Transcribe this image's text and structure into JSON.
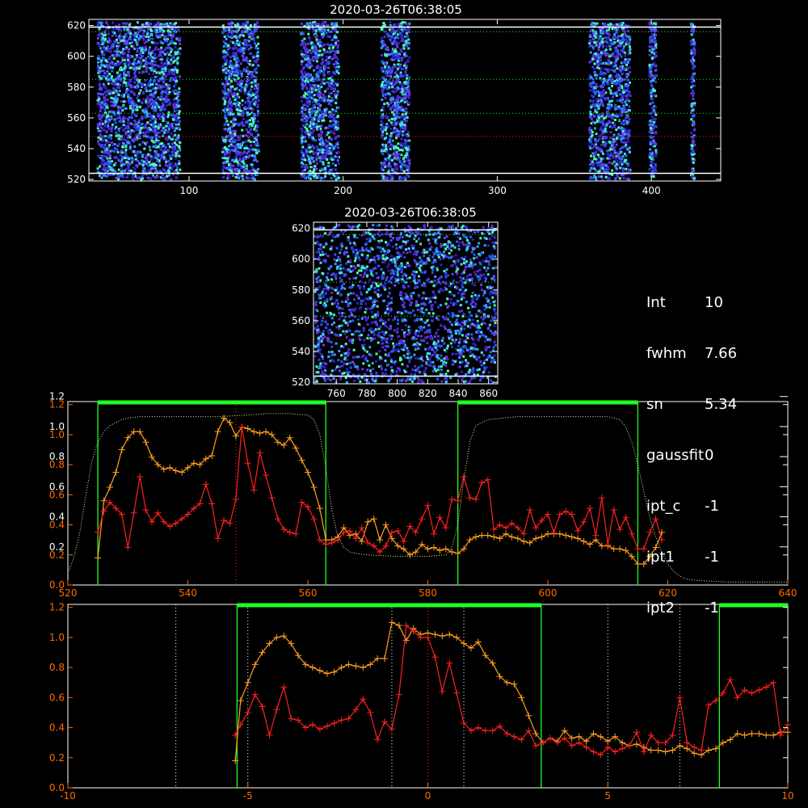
{
  "info": {
    "rows": [
      {
        "key": "Int",
        "value": "10"
      },
      {
        "key": "fwhm",
        "value": "7.66"
      },
      {
        "key": "sn",
        "value": "5.34"
      },
      {
        "key": "gaussfit",
        "value": "0"
      },
      {
        "key": "ipt_c",
        "value": "-1"
      },
      {
        "key": "ipt1",
        "value": "-1"
      },
      {
        "key": "ipt2",
        "value": "-1"
      }
    ]
  },
  "colors": {
    "red": "#ff2020",
    "orange": "#ffa020",
    "green": "#20ff20",
    "dotted": "#c8ffa0",
    "axis": "#ff6a00"
  },
  "chart_data": [
    {
      "type": "heatmap",
      "title": "2020-03-26T06:38:05",
      "xlim": [
        35,
        445
      ],
      "ylim": [
        519,
        624
      ],
      "xticks": [
        100,
        200,
        300,
        400
      ],
      "yticks": [
        520,
        540,
        560,
        580,
        600,
        620
      ],
      "hlines_white": [
        524,
        619
      ],
      "hlines_green_dotted": [
        563,
        585,
        616
      ],
      "hlines_red_dotted": [
        548
      ],
      "bands": [
        [
          40,
          95
        ],
        [
          121,
          146
        ],
        [
          172,
          198
        ],
        [
          224,
          244
        ],
        [
          359,
          387
        ],
        [
          398,
          404
        ],
        [
          425,
          429
        ]
      ]
    },
    {
      "type": "heatmap",
      "title": "2020-03-26T06:38:05",
      "xlim": [
        745,
        866
      ],
      "ylim": [
        519,
        624
      ],
      "xticks": [
        760,
        780,
        800,
        820,
        840,
        860
      ],
      "yticks": [
        520,
        540,
        560,
        580,
        600,
        620
      ],
      "hlines_white": [
        524,
        619
      ],
      "hlines_green_dotted": [
        563,
        585,
        616
      ],
      "hlines_red_dotted": [
        548
      ]
    },
    {
      "type": "line",
      "xlim": [
        520,
        640
      ],
      "ylim": [
        0,
        1.22
      ],
      "xticks": [
        520,
        540,
        560,
        580,
        600,
        620,
        640
      ],
      "yticks_orange": [
        0.0,
        0.2,
        0.4,
        0.6,
        0.8,
        1.0,
        1.2
      ],
      "yticks_white": [
        0.2,
        0.4,
        0.6,
        0.8,
        1.0,
        1.2
      ],
      "green_vlines": [
        525,
        563,
        585,
        615
      ],
      "green_bars": [
        [
          525,
          563
        ],
        [
          585,
          615
        ]
      ],
      "red_vline": 548,
      "series": [
        {
          "color": "orange",
          "x": [
            525,
            526,
            527,
            528,
            529,
            530,
            531,
            532,
            533,
            534,
            535,
            536,
            537,
            538,
            539,
            540,
            541,
            542,
            543,
            544,
            545,
            546,
            547,
            548,
            549,
            550,
            551,
            552,
            553,
            554,
            555,
            556,
            557,
            558,
            559,
            560,
            561,
            562,
            563,
            564,
            565,
            566,
            567,
            568,
            569,
            570,
            571,
            572,
            573,
            574,
            575,
            576,
            577,
            578,
            579,
            580,
            581,
            582,
            583,
            584,
            585,
            586,
            587,
            588,
            589,
            590,
            591,
            592,
            593,
            594,
            595,
            596,
            597,
            598,
            599,
            600,
            601,
            602,
            603,
            604,
            605,
            606,
            607,
            608,
            609,
            610,
            611,
            612,
            613,
            614,
            615,
            616,
            617,
            618,
            619
          ],
          "y": [
            0.18,
            0.56,
            0.65,
            0.75,
            0.9,
            0.98,
            1.02,
            1.02,
            0.95,
            0.85,
            0.8,
            0.77,
            0.78,
            0.76,
            0.75,
            0.78,
            0.81,
            0.8,
            0.84,
            0.86,
            1.02,
            1.11,
            1.08,
            0.99,
            1.05,
            1.04,
            1.02,
            1.01,
            1.02,
            1.0,
            0.95,
            0.93,
            0.98,
            0.91,
            0.83,
            0.75,
            0.65,
            0.51,
            0.3,
            0.3,
            0.32,
            0.38,
            0.33,
            0.34,
            0.29,
            0.42,
            0.44,
            0.3,
            0.4,
            0.31,
            0.26,
            0.24,
            0.2,
            0.22,
            0.27,
            0.24,
            0.25,
            0.23,
            0.24,
            0.22,
            0.21,
            0.24,
            0.3,
            0.32,
            0.33,
            0.33,
            0.32,
            0.31,
            0.34,
            0.32,
            0.31,
            0.29,
            0.28,
            0.31,
            0.32,
            0.34,
            0.34,
            0.34,
            0.33,
            0.32,
            0.31,
            0.29,
            0.27,
            0.3,
            0.26,
            0.26,
            0.24,
            0.24,
            0.23,
            0.19,
            0.14,
            0.14,
            0.19,
            0.25,
            0.35
          ]
        },
        {
          "color": "red",
          "x": [
            525,
            526,
            527,
            528,
            529,
            530,
            531,
            532,
            533,
            534,
            535,
            536,
            537,
            538,
            539,
            540,
            541,
            542,
            543,
            544,
            545,
            546,
            547,
            548,
            549,
            550,
            551,
            552,
            553,
            554,
            555,
            556,
            557,
            558,
            559,
            560,
            561,
            562,
            563,
            564,
            565,
            566,
            567,
            568,
            569,
            570,
            571,
            572,
            573,
            574,
            575,
            576,
            577,
            578,
            579,
            580,
            581,
            582,
            583,
            584,
            585,
            586,
            587,
            588,
            589,
            590,
            591,
            592,
            593,
            594,
            595,
            596,
            597,
            598,
            599,
            600,
            601,
            602,
            603,
            604,
            605,
            606,
            607,
            608,
            609,
            610,
            611,
            612,
            613,
            614,
            615,
            616,
            617,
            618,
            619
          ],
          "y": [
            0.35,
            0.49,
            0.55,
            0.51,
            0.47,
            0.25,
            0.48,
            0.72,
            0.5,
            0.42,
            0.48,
            0.42,
            0.39,
            0.41,
            0.44,
            0.47,
            0.51,
            0.54,
            0.67,
            0.54,
            0.31,
            0.43,
            0.41,
            0.57,
            1.05,
            0.81,
            0.63,
            0.88,
            0.73,
            0.58,
            0.44,
            0.37,
            0.35,
            0.34,
            0.55,
            0.52,
            0.44,
            0.3,
            0.27,
            0.28,
            0.3,
            0.35,
            0.36,
            0.31,
            0.38,
            0.28,
            0.26,
            0.22,
            0.26,
            0.35,
            0.36,
            0.29,
            0.39,
            0.35,
            0.44,
            0.53,
            0.34,
            0.45,
            0.38,
            0.57,
            0.56,
            0.72,
            0.58,
            0.57,
            0.68,
            0.7,
            0.37,
            0.4,
            0.38,
            0.41,
            0.38,
            0.34,
            0.5,
            0.38,
            0.43,
            0.47,
            0.35,
            0.47,
            0.49,
            0.47,
            0.36,
            0.42,
            0.51,
            0.33,
            0.58,
            0.27,
            0.5,
            0.37,
            0.45,
            0.34,
            0.24,
            0.24,
            0.35,
            0.44,
            0.3
          ]
        },
        {
          "color": "dotted",
          "x": [
            520,
            521,
            522,
            523,
            524,
            525,
            526,
            527,
            528,
            529,
            530,
            532,
            535,
            540,
            545,
            550,
            553,
            555,
            557,
            560,
            561,
            562,
            563,
            564,
            565,
            566,
            567,
            568,
            570,
            575,
            580,
            583,
            584,
            585,
            586,
            587,
            588,
            590,
            595,
            600,
            605,
            610,
            612,
            613,
            614,
            615,
            616,
            617,
            618,
            619,
            620,
            621,
            622,
            623,
            625,
            630,
            635,
            640
          ],
          "y": [
            0.08,
            0.18,
            0.35,
            0.6,
            0.82,
            0.95,
            1.02,
            1.06,
            1.08,
            1.1,
            1.11,
            1.12,
            1.12,
            1.12,
            1.12,
            1.13,
            1.14,
            1.14,
            1.14,
            1.13,
            1.1,
            1.0,
            0.78,
            0.5,
            0.32,
            0.25,
            0.22,
            0.21,
            0.2,
            0.19,
            0.19,
            0.2,
            0.25,
            0.4,
            0.7,
            0.95,
            1.06,
            1.1,
            1.12,
            1.12,
            1.12,
            1.12,
            1.1,
            1.05,
            0.95,
            0.8,
            0.62,
            0.45,
            0.32,
            0.22,
            0.14,
            0.09,
            0.06,
            0.04,
            0.03,
            0.02,
            0.02,
            0.02
          ]
        }
      ]
    },
    {
      "type": "line",
      "xlim": [
        -10,
        10
      ],
      "ylim": [
        0,
        1.22
      ],
      "xticks": [
        -10,
        -5,
        0,
        5,
        10
      ],
      "yticks": [
        0.0,
        0.2,
        0.4,
        0.6,
        0.8,
        1.0,
        1.2
      ],
      "green_vlines": [
        -5.3,
        3.15,
        8.1
      ],
      "green_bars": [
        [
          -5.3,
          3.15
        ],
        [
          8.1,
          10
        ]
      ],
      "white_dotted_vlines": [
        -7,
        -5,
        -1,
        1,
        5,
        7
      ],
      "red_vline": 0,
      "series": [
        {
          "color": "orange",
          "x": [
            -5.35,
            -5.2,
            -5.0,
            -4.8,
            -4.6,
            -4.4,
            -4.2,
            -4.0,
            -3.8,
            -3.6,
            -3.4,
            -3.2,
            -3.0,
            -2.8,
            -2.6,
            -2.4,
            -2.2,
            -2.0,
            -1.8,
            -1.6,
            -1.4,
            -1.2,
            -1.0,
            -0.8,
            -0.6,
            -0.4,
            -0.2,
            0.0,
            0.2,
            0.4,
            0.6,
            0.8,
            1.0,
            1.2,
            1.4,
            1.6,
            1.8,
            2.0,
            2.2,
            2.4,
            2.6,
            2.8,
            3.0,
            3.2,
            3.4,
            3.6,
            3.8,
            4.0,
            4.2,
            4.4,
            4.6,
            4.8,
            5.0,
            5.2,
            5.4,
            5.6,
            5.8,
            6.0,
            6.2,
            6.4,
            6.6,
            6.8,
            7.0,
            7.2,
            7.4,
            7.6,
            7.8,
            8.0,
            8.2,
            8.4,
            8.6,
            8.8,
            9.0,
            9.2,
            9.4,
            9.6,
            9.8,
            10.0
          ],
          "y": [
            0.18,
            0.58,
            0.7,
            0.82,
            0.9,
            0.96,
            1.0,
            1.01,
            0.96,
            0.88,
            0.82,
            0.8,
            0.78,
            0.76,
            0.77,
            0.8,
            0.82,
            0.81,
            0.8,
            0.82,
            0.86,
            0.86,
            1.1,
            1.08,
            0.98,
            1.06,
            1.02,
            1.03,
            1.02,
            1.01,
            1.02,
            1.0,
            0.96,
            0.93,
            0.97,
            0.88,
            0.83,
            0.74,
            0.7,
            0.69,
            0.6,
            0.48,
            0.36,
            0.3,
            0.33,
            0.31,
            0.38,
            0.33,
            0.34,
            0.31,
            0.36,
            0.34,
            0.31,
            0.34,
            0.3,
            0.28,
            0.29,
            0.27,
            0.25,
            0.25,
            0.24,
            0.25,
            0.28,
            0.26,
            0.23,
            0.22,
            0.25,
            0.26,
            0.3,
            0.32,
            0.36,
            0.35,
            0.36,
            0.36,
            0.35,
            0.35,
            0.37,
            0.37
          ]
        },
        {
          "color": "red",
          "x": [
            -5.35,
            -5.2,
            -5.0,
            -4.8,
            -4.6,
            -4.4,
            -4.2,
            -4.0,
            -3.8,
            -3.6,
            -3.4,
            -3.2,
            -3.0,
            -2.8,
            -2.6,
            -2.4,
            -2.2,
            -2.0,
            -1.8,
            -1.6,
            -1.4,
            -1.2,
            -1.0,
            -0.8,
            -0.6,
            -0.4,
            -0.2,
            0.0,
            0.2,
            0.4,
            0.6,
            0.8,
            1.0,
            1.2,
            1.4,
            1.6,
            1.8,
            2.0,
            2.2,
            2.4,
            2.6,
            2.8,
            3.0,
            3.2,
            3.4,
            3.6,
            3.8,
            4.0,
            4.2,
            4.4,
            4.6,
            4.8,
            5.0,
            5.2,
            5.4,
            5.6,
            5.8,
            6.0,
            6.2,
            6.4,
            6.6,
            6.8,
            7.0,
            7.2,
            7.4,
            7.6,
            7.8,
            8.0,
            8.2,
            8.4,
            8.6,
            8.8,
            9.0,
            9.2,
            9.4,
            9.6,
            9.8,
            10.0
          ],
          "y": [
            0.35,
            0.42,
            0.5,
            0.62,
            0.54,
            0.35,
            0.52,
            0.67,
            0.46,
            0.45,
            0.4,
            0.42,
            0.39,
            0.41,
            0.43,
            0.45,
            0.46,
            0.52,
            0.59,
            0.5,
            0.32,
            0.44,
            0.39,
            0.62,
            1.08,
            1.04,
            1.0,
            1.0,
            0.87,
            0.64,
            0.83,
            0.63,
            0.43,
            0.38,
            0.4,
            0.38,
            0.38,
            0.41,
            0.36,
            0.34,
            0.32,
            0.38,
            0.28,
            0.3,
            0.33,
            0.3,
            0.33,
            0.28,
            0.3,
            0.27,
            0.24,
            0.22,
            0.27,
            0.24,
            0.26,
            0.28,
            0.37,
            0.24,
            0.35,
            0.3,
            0.3,
            0.35,
            0.6,
            0.3,
            0.27,
            0.25,
            0.55,
            0.58,
            0.63,
            0.72,
            0.6,
            0.65,
            0.63,
            0.65,
            0.67,
            0.7,
            0.35,
            0.42
          ]
        }
      ]
    }
  ]
}
